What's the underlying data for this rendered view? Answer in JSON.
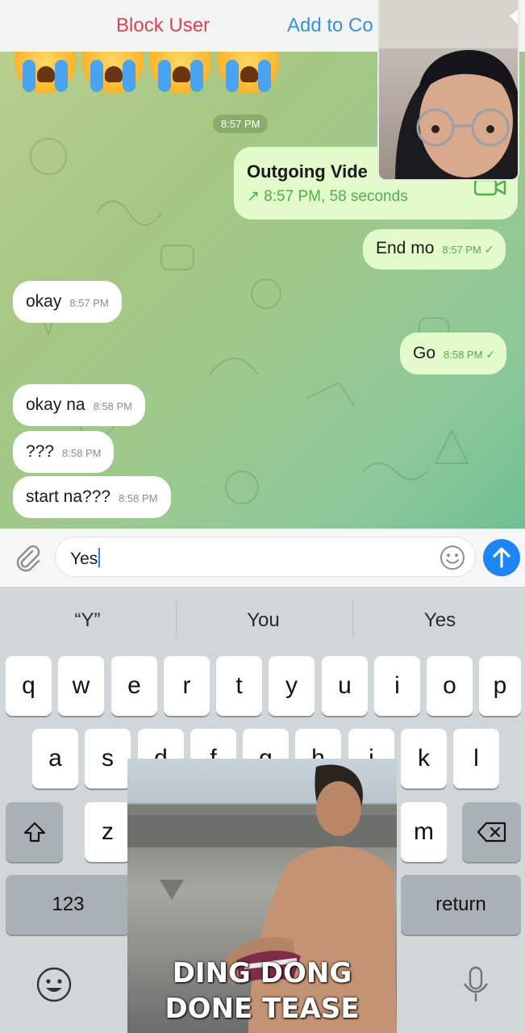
{
  "topbar": {
    "block_user": "Block User",
    "add_contact": "Add to Co"
  },
  "chat": {
    "date_chip": "8:57 PM",
    "video_call": {
      "title": "Outgoing Vide",
      "meta": "↗ 8:57 PM, 58 seconds",
      "icon": "video-camera-icon"
    },
    "messages": [
      {
        "direction": "out",
        "text": "End mo",
        "time": "8:57 PM",
        "read": true
      },
      {
        "direction": "in",
        "text": "okay",
        "time": "8:57 PM"
      },
      {
        "direction": "out",
        "text": "Go",
        "time": "8:58 PM",
        "read": true
      },
      {
        "direction": "in",
        "text": "okay na",
        "time": "8:58 PM"
      },
      {
        "direction": "in",
        "text": "???",
        "time": "8:58 PM"
      },
      {
        "direction": "in",
        "text": "start na???",
        "time": "8:58 PM"
      }
    ],
    "emoji_top": [
      "loudly-crying-face",
      "loudly-crying-face",
      "loudly-crying-face",
      "loudly-crying-face"
    ]
  },
  "input": {
    "value": "Yes",
    "attach_icon": "paperclip-icon",
    "sticker_icon": "smile-icon",
    "send_icon": "arrow-up-icon"
  },
  "keyboard": {
    "suggestions": [
      "“Y”",
      "You",
      "Yes"
    ],
    "row1": [
      "q",
      "w",
      "e",
      "r",
      "t",
      "y",
      "u",
      "i",
      "o",
      "p"
    ],
    "row2": [
      "a",
      "s",
      "d",
      "f",
      "g",
      "h",
      "j",
      "k",
      "l"
    ],
    "row3": [
      "z",
      "m"
    ],
    "numbers": "123",
    "return": "return",
    "shift_icon": "shift-icon",
    "delete_icon": "backspace-icon",
    "emoji_icon": "emoji-icon",
    "mic_icon": "microphone-icon"
  },
  "meme": {
    "line1": "DING DONG",
    "line2": "DONE TEASE"
  },
  "colors": {
    "send": "#1e85f5",
    "outgoing_bubble": "#e3fbcb",
    "block_user": "#d9454e",
    "add_contact": "#3a8fdc"
  }
}
